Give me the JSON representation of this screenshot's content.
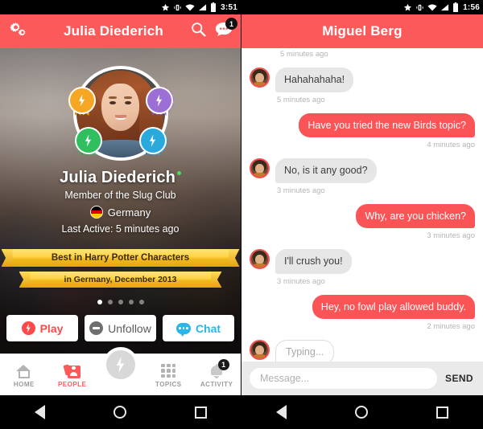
{
  "left": {
    "statusbar": {
      "time": "3:51",
      "icons": [
        "star-icon",
        "vibrate-icon",
        "wifi-icon",
        "signal-icon",
        "battery-icon"
      ]
    },
    "appbar": {
      "title": "Julia Diederich",
      "settings_icon": "gears-icon",
      "search_icon": "search-icon",
      "messages_icon": "chat-bubble-icon",
      "messages_badge": "1"
    },
    "profile": {
      "name": "Julia Diederich",
      "subtitle": "Member of the Slug Club",
      "country": "Germany",
      "last_active": "Last Active: 5 minutes ago",
      "online": true,
      "badges": [
        {
          "name": "badge-orange",
          "color": "#f5a623"
        },
        {
          "name": "badge-purple",
          "color": "#9b6fd6"
        },
        {
          "name": "badge-green",
          "color": "#2fbf5e"
        },
        {
          "name": "badge-blue",
          "color": "#2aa9dd"
        }
      ],
      "flag_colors": [
        "#000000",
        "#dd0000",
        "#ffce00"
      ]
    },
    "ribbons": [
      "Best in Harry Potter Characters",
      "in Germany, December 2013"
    ],
    "pager": {
      "count": 5,
      "active": 0
    },
    "actions": [
      {
        "label": "Play",
        "icon": "bolt-icon",
        "color": "#fc4a4a"
      },
      {
        "label": "Unfollow",
        "icon": "minus-circle-icon",
        "color": "#5a5a5a"
      },
      {
        "label": "Chat",
        "icon": "chat-bubble-icon",
        "color": "#29b6e8"
      }
    ],
    "tabs": [
      {
        "label": "HOME",
        "icon": "home-icon",
        "active": false,
        "badge": ""
      },
      {
        "label": "PEOPLE",
        "icon": "people-icon",
        "active": true,
        "badge": ""
      },
      {
        "label": "TOPICS",
        "icon": "grid-icon",
        "active": false,
        "badge": ""
      },
      {
        "label": "ACTIVITY",
        "icon": "bell-icon",
        "active": false,
        "badge": "1"
      }
    ],
    "fab": {
      "icon": "bolt-icon"
    }
  },
  "right": {
    "statusbar": {
      "time": "1:56"
    },
    "appbar": {
      "title": "Miguel Berg"
    },
    "top_timestamp": "5 minutes ago",
    "messages": [
      {
        "side": "in",
        "text": "Hahahahaha!",
        "time": "5 minutes ago"
      },
      {
        "side": "out",
        "text": "Have you tried the new Birds topic?",
        "time": "4 minutes ago"
      },
      {
        "side": "in",
        "text": "No, is it any good?",
        "time": "3 minutes ago"
      },
      {
        "side": "out",
        "text": "Why, are you chicken?",
        "time": "3 minutes ago"
      },
      {
        "side": "in",
        "text": "I'll crush you!",
        "time": "3 minutes ago"
      },
      {
        "side": "out",
        "text": "Hey, no fowl play allowed buddy.",
        "time": "2 minutes ago"
      }
    ],
    "typing": {
      "text": "Typing..."
    },
    "composer": {
      "placeholder": "Message...",
      "send_label": "SEND"
    }
  },
  "navbar": {
    "back": "back-icon",
    "home": "home-circle-icon",
    "recents": "recents-icon"
  },
  "colors": {
    "accent": "#fc5a5a",
    "bubble_out": "#fb5457",
    "bubble_in": "#e6e6e6"
  }
}
